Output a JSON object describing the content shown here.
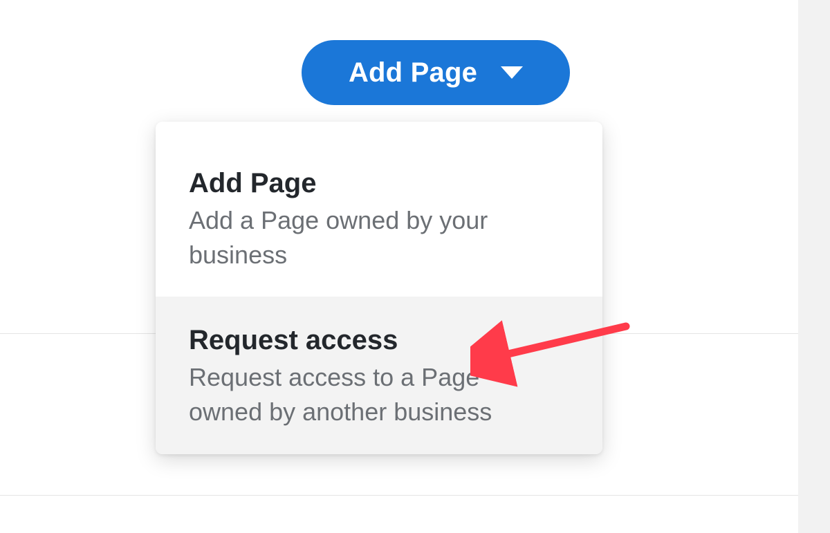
{
  "button": {
    "label": "Add Page"
  },
  "dropdown": {
    "items": [
      {
        "title": "Add Page",
        "description": "Add a Page owned by your business"
      },
      {
        "title": "Request access",
        "description": "Request access to a Page owned by another business"
      }
    ]
  },
  "colors": {
    "accent": "#1b77d8",
    "annotation": "#ff3b4a"
  }
}
